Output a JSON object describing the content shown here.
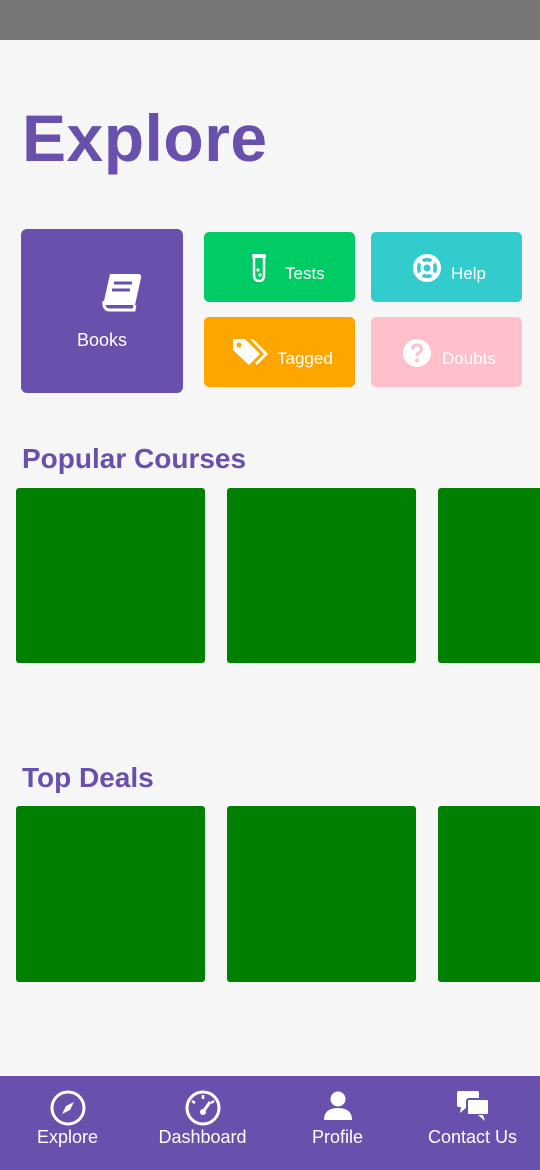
{
  "page": {
    "title": "Explore"
  },
  "quick_links": [
    {
      "label": "Books",
      "icon": "book-icon",
      "color": "#6950ad"
    },
    {
      "label": "Tests",
      "icon": "test-tube-icon",
      "color": "#00cc66"
    },
    {
      "label": "Help",
      "icon": "lifebuoy-icon",
      "color": "#33cccc"
    },
    {
      "label": "Tagged",
      "icon": "tags-icon",
      "color": "#ffa500"
    },
    {
      "label": "Doubts",
      "icon": "question-circle-icon",
      "color": "#ffc0cb"
    }
  ],
  "sections": {
    "popular_courses": {
      "title": "Popular Courses",
      "card_color": "#008000"
    },
    "top_deals": {
      "title": "Top Deals",
      "card_color": "#008000"
    }
  },
  "bottom_nav": [
    {
      "label": "Explore",
      "icon": "compass-icon"
    },
    {
      "label": "Dashboard",
      "icon": "speedometer-icon"
    },
    {
      "label": "Profile",
      "icon": "user-icon"
    },
    {
      "label": "Contact Us",
      "icon": "chat-icon"
    }
  ],
  "colors": {
    "accent": "#6950ad",
    "status_bar": "#777777",
    "background": "#f6f6f6"
  }
}
